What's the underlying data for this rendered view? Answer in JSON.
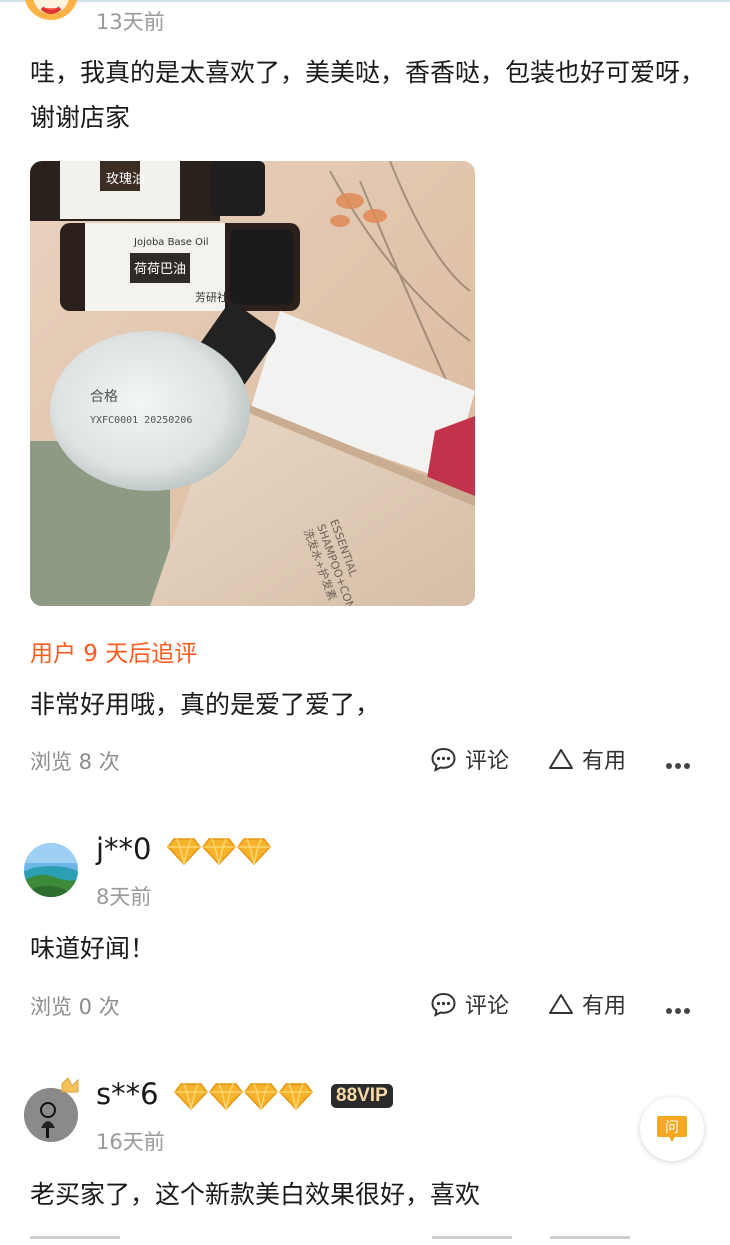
{
  "review1": {
    "time": "13天前",
    "text": "哇，我真的是太喜欢了，美美哒，香香哒，包装也好可爱呀，谢谢店家",
    "followup_label": "用户 9 天后追评",
    "followup_text": "非常好用哦，真的是爱了爱了，",
    "views": "浏览 8 次",
    "comment_label": "评论",
    "useful_label": "有用",
    "photo_labels": {
      "bottle1_cap": "玫瑰油",
      "bottle2_label": "荷荷巴油",
      "bottle2_sub": "Jojoba Base Oil",
      "brand": "芳研社",
      "bottle3_text": "合格",
      "bottle3_code": "YXFC0001 20250206",
      "box_line1": "ESSENTIAL",
      "box_line2": "SHAMPOO+CONDI",
      "box_line3": "洗发水+护发素"
    }
  },
  "review2": {
    "username": "j**0",
    "diamonds": 3,
    "time": "8天前",
    "text": "味道好闻！",
    "views": "浏览 0 次",
    "comment_label": "评论",
    "useful_label": "有用"
  },
  "review3": {
    "username": "s**6",
    "diamonds": 4,
    "badge": "88VIP",
    "time": "16天前",
    "text": "老买家了，这个新款美白效果很好，喜欢"
  },
  "ask_button": {
    "label": "问"
  },
  "colors": {
    "accent": "#ff5a1f",
    "diamond": "#f7b32b",
    "ask": "#f5a623"
  },
  "icons": [
    "avatar-icon",
    "diamond-icon",
    "comment-icon",
    "useful-icon",
    "more-icon",
    "ask-icon"
  ]
}
